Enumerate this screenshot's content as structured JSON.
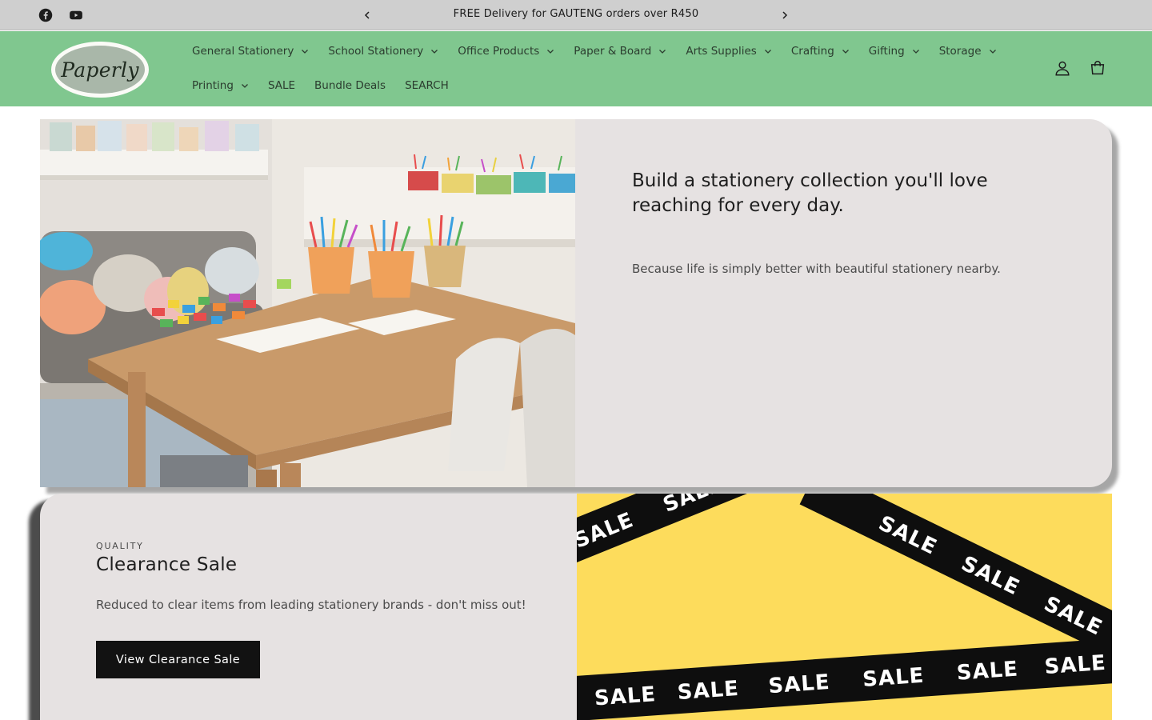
{
  "announcement": {
    "text": "FREE Delivery for GAUTENG orders over R450",
    "social": [
      {
        "name": "facebook-icon"
      },
      {
        "name": "youtube-icon"
      }
    ]
  },
  "header": {
    "logo_text": "Paperly",
    "nav_row1": [
      {
        "label": "General Stationery",
        "dropdown": true
      },
      {
        "label": "School Stationery",
        "dropdown": true
      },
      {
        "label": "Office Products",
        "dropdown": true
      },
      {
        "label": "Paper & Board",
        "dropdown": true
      },
      {
        "label": "Arts Supplies",
        "dropdown": true
      },
      {
        "label": "Crafting",
        "dropdown": true
      },
      {
        "label": "Gifting",
        "dropdown": true
      },
      {
        "label": "Storage",
        "dropdown": true
      }
    ],
    "nav_row2": [
      {
        "label": "Printing",
        "dropdown": true
      },
      {
        "label": "SALE",
        "dropdown": false
      },
      {
        "label": "Bundle Deals",
        "dropdown": false
      },
      {
        "label": "SEARCH",
        "dropdown": false
      }
    ],
    "icons": [
      "account-icon",
      "cart-icon"
    ]
  },
  "hero": {
    "title": "Build a stationery collection you'll love reaching for every day.",
    "subtitle": "Because life is simply better with beautiful stationery nearby."
  },
  "clearance": {
    "eyebrow": "QUALITY",
    "title": "Clearance Sale",
    "description": "Reduced to clear items from leading stationery brands - don't miss out!",
    "button_label": "View Clearance Sale",
    "tape_word": "SALE"
  },
  "colors": {
    "announcement_bg": "#cfcfcf",
    "header_bg": "#80c78f",
    "card_bg": "#e6e2e2",
    "button_bg": "#121212",
    "sale_yellow": "#fddc5c"
  }
}
